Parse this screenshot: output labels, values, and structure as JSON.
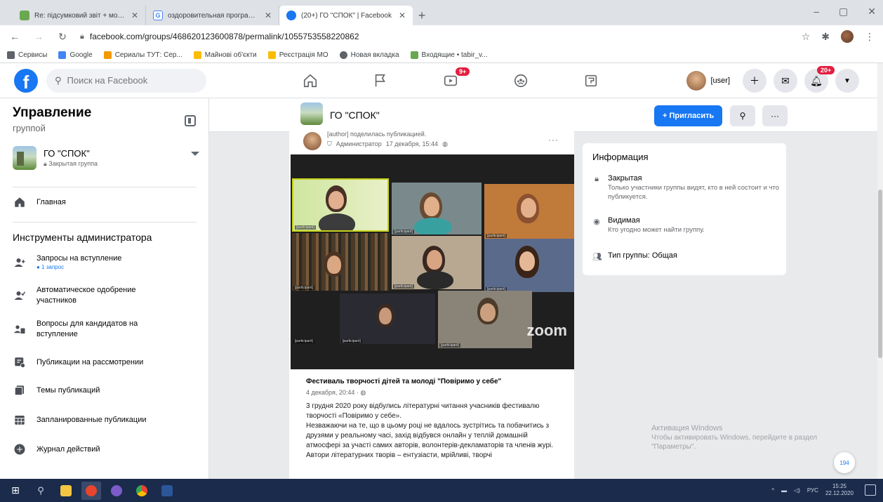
{
  "browser": {
    "tabs": [
      {
        "title": "Re: підсумковий звіт + монітор",
        "color": "#6aa84f",
        "active": false
      },
      {
        "title": "оздоровительная программа",
        "color": "#4285f4",
        "active": false
      },
      {
        "title": "(20+) ГО \"СПОК\" | Facebook",
        "color": "#1877f2",
        "active": true
      }
    ],
    "new_tab": "+",
    "window_controls": [
      "–",
      "▢",
      "✕"
    ],
    "url": "facebook.com/groups/468620123600878/permalink/1055753558220862",
    "bookmarks": [
      {
        "label": "Сервисы",
        "color": "#5f6368"
      },
      {
        "label": "Google",
        "color": "#4285f4"
      },
      {
        "label": "Сериалы ТУТ: Сер...",
        "color": "#f29900"
      },
      {
        "label": "Майнові об'єкти",
        "color": "#fbbc04"
      },
      {
        "label": "Реєстрація МО",
        "color": "#fbbc04"
      },
      {
        "label": "Новая вкладка",
        "color": "#5f6368"
      },
      {
        "label": "Входящие • tabir_v...",
        "color": "#6aa84f"
      }
    ]
  },
  "fb": {
    "search_placeholder": "Поиск на Facebook",
    "nav": {
      "watch_badge": "9+",
      "notif_badge": "20+"
    },
    "profile_name": "[user]"
  },
  "sidebar": {
    "title_line1": "Управление",
    "title_line2": "группой",
    "group": {
      "name": "ГО \"СПОК\"",
      "privacy": "Закрытая группа"
    },
    "home": "Главная",
    "admin_tools_title": "Инструменты администратора",
    "items": [
      {
        "label": "Запросы на вступление",
        "sub": "1 запрос"
      },
      {
        "label": "Автоматическое одобрение участников",
        "sub": ""
      },
      {
        "label": "Вопросы для кандидатов на вступление",
        "sub": ""
      },
      {
        "label": "Публикации на рассмотрении",
        "sub": ""
      },
      {
        "label": "Темы публикаций",
        "sub": ""
      },
      {
        "label": "Запланированные публикации",
        "sub": ""
      },
      {
        "label": "Журнал действий",
        "sub": ""
      }
    ]
  },
  "group_header": {
    "name": "ГО \"СПОК\"",
    "invite_label": "+ Пригласить",
    "more_label": "···"
  },
  "post": {
    "author_line": "[author] поделилась публикацией.",
    "role": "Администратор",
    "timestamp": "17 декабря, 15:44",
    "more": "···",
    "zoom_brand": "zoom",
    "participants": [
      "[participant]",
      "[participant]",
      "[participant]",
      "[participant]",
      "[participant]",
      "[participant]",
      "[participant]",
      "[participant]",
      "[participant]"
    ],
    "shared_title": "Фестиваль творчості дітей та молоді \"Повіримо у себе\"",
    "shared_date": "4 декабря, 20:44",
    "body": [
      "3 грудня 2020 року відбулись літературні читання учасників фестивалю творчості «Повіримо у себе».",
      "Незважаючи на те, що в цьому році не вдалось зустрітись та побачитись з друзями у реальному часі, захід відбувся онлайн у теплій домашній атмосфері за участі самих авторів, волонтерів-декламаторів та членів журі.",
      "Автори літературних творів – ентузіасти, мрійливі, творчі"
    ]
  },
  "info": {
    "title": "Информация",
    "rows": [
      {
        "head": "Закрытая",
        "desc": "Только участники группы видят, кто в ней состоит и что публикуется."
      },
      {
        "head": "Видимая",
        "desc": "Кто угодно может найти группу."
      },
      {
        "head": "Тип группы: Общая",
        "desc": ""
      }
    ]
  },
  "activation": {
    "line1": "Активация Windows",
    "line2": "Чтобы активировать Windows, перейдите в раздел \"Параметры\"."
  },
  "chat_count": "194",
  "taskbar": {
    "lang": "РУС",
    "time": "15:25",
    "date": "22.12.2020"
  }
}
